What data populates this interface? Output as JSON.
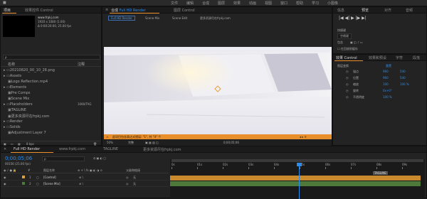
{
  "menubar": [
    "文件",
    "编辑",
    "合成",
    "图层",
    "效果",
    "动画",
    "视图",
    "窗口",
    "帮助",
    "学习",
    "小图像"
  ],
  "project_panel": {
    "tabs": [
      "项目",
      "效果控件 Control"
    ],
    "preview_info": [
      "www.frpkj.com",
      "1920 x 1080 (1.00)",
      "Δ 0:00:20:00, 25.00 fps"
    ],
    "search_placeholder": "ρ",
    "columns": {
      "name": "名称",
      "comment": "注释"
    },
    "items": [
      {
        "name": "20210820_00_10_28.png",
        "type": "",
        "indent": 0
      },
      {
        "name": "Assets",
        "type": "",
        "indent": 0
      },
      {
        "name": "Logo Reflection.mp4",
        "type": "",
        "indent": 1
      },
      {
        "name": "Elements",
        "type": "",
        "indent": 0
      },
      {
        "name": "Pre Comps",
        "type": "",
        "indent": 1
      },
      {
        "name": "Scene Mix",
        "type": "",
        "indent": 1
      },
      {
        "name": "Placeholders",
        "type": "1080/TAG",
        "indent": 0
      },
      {
        "name": "TAGLINE",
        "type": "",
        "indent": 1
      },
      {
        "name": "更多资源尽在frpkj.com",
        "type": "",
        "indent": 1
      },
      {
        "name": "Render",
        "type": "",
        "indent": 0
      },
      {
        "name": "Solids",
        "type": "",
        "indent": 0
      },
      {
        "name": "Adjustment Layer 7",
        "type": "",
        "indent": 1
      }
    ],
    "bpc": "8 bpc"
  },
  "composition_panel": {
    "title_tab": "合成 Full HD Render",
    "layer_tab": "图层 Control",
    "sub_tabs": [
      "Full HD Render",
      "Scene Mix",
      "Scene Edit",
      "更多资源尽在frpkj.com"
    ],
    "zoom": "50%",
    "resolution": "完整",
    "timecode": "0;00;05;06",
    "status_text": "此项目包含表达式错误: \"1\", 共 \"4\" 个",
    "colors": {
      "status_bar": "#e88f2b"
    }
  },
  "info_panel": {
    "tabs": [
      "信息",
      "预览",
      "对齐",
      "音频"
    ],
    "labels": [
      "快捷键",
      "空格键",
      "包含",
      "在回放前缓存"
    ],
    "effects_tabs": [
      "效果 Control",
      "效果和预设",
      "字符",
      "段落"
    ]
  },
  "effect_controls": {
    "section": "图层变换",
    "reset": "重置",
    "props": [
      {
        "name": "锚点",
        "v1": "960",
        "v2": "540"
      },
      {
        "name": "位置",
        "v1": "960",
        "v2": "540"
      },
      {
        "name": "缩放",
        "v1": "100",
        "v2": "100 %"
      },
      {
        "name": "旋转",
        "v1": "0x+0°",
        "v2": ""
      },
      {
        "name": "不透明度",
        "v1": "100 %",
        "v2": ""
      }
    ]
  },
  "timeline": {
    "tabs": [
      "Full HD Render",
      "www.frpkj.com",
      "TAGLINE",
      "更多资源尽在frpkj.com"
    ],
    "timecode": "0;00;05;06",
    "frame_info": "00156 (25.00 fps)",
    "search_placeholder": "ρ",
    "col_layer_name": "图层名称",
    "col_parent": "父级和链接",
    "ruler": [
      "0s",
      "01s",
      "02s",
      "03s",
      "04s",
      "05s",
      "06s",
      "07s",
      "08s",
      "09s"
    ],
    "tagline_marker": "TAGLINE",
    "layers": [
      {
        "num": "1",
        "name": "[Control]",
        "parent": "无"
      },
      {
        "num": "2",
        "name": "[Scene Mix]",
        "parent": "无"
      }
    ]
  }
}
